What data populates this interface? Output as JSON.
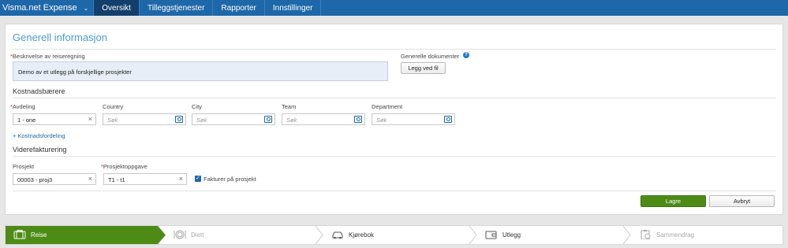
{
  "topbar": {
    "brand": "Visma.net Expense",
    "tabs": [
      "Oversikt",
      "Tilleggstjenester",
      "Rapporter",
      "Innstillinger"
    ]
  },
  "card": {
    "title": "Generell informasjon",
    "description_label": "Beskrivelse av reiseregning",
    "description_value": "Demo av et utlegg på forskjellige prosjekter",
    "documents_label": "Generelle dokumenter",
    "add_file_label": "Legg ved fil",
    "cost_carriers": {
      "heading": "Kostnadsbærere",
      "avdeling_label": "Avdeling",
      "avdeling_value": "1 - one",
      "country_label": "Country",
      "city_label": "City",
      "team_label": "Team",
      "department_label": "Department",
      "search_placeholder": "Søk",
      "cost_distribution_link": "+ Kostnadsfordeling"
    },
    "rebilling": {
      "heading": "Viderefakturering",
      "project_label": "Prosjekt",
      "project_value": "00003 - proj3",
      "task_label": "Prosjektoppgave",
      "task_value": "T1 - t1",
      "invoice_checkbox_label": "Fakturer på prosjekt"
    },
    "save_label": "Lagre",
    "cancel_label": "Avbryt"
  },
  "steps": [
    {
      "label": "Reise",
      "state": "active",
      "icon": "suitcase-icon"
    },
    {
      "label": "Diett",
      "state": "disabled",
      "icon": "plate-icon"
    },
    {
      "label": "Kjørebok",
      "state": "normal",
      "icon": "car-icon"
    },
    {
      "label": "Utlegg",
      "state": "normal",
      "icon": "wallet-icon"
    },
    {
      "label": "Sammendrag",
      "state": "disabled",
      "icon": "clipboard-icon"
    }
  ],
  "colors": {
    "topbar": "#1e67a8",
    "active_tab": "#123f6b",
    "primary_green": "#4d8b16",
    "heading_blue": "#4d9bd6"
  }
}
